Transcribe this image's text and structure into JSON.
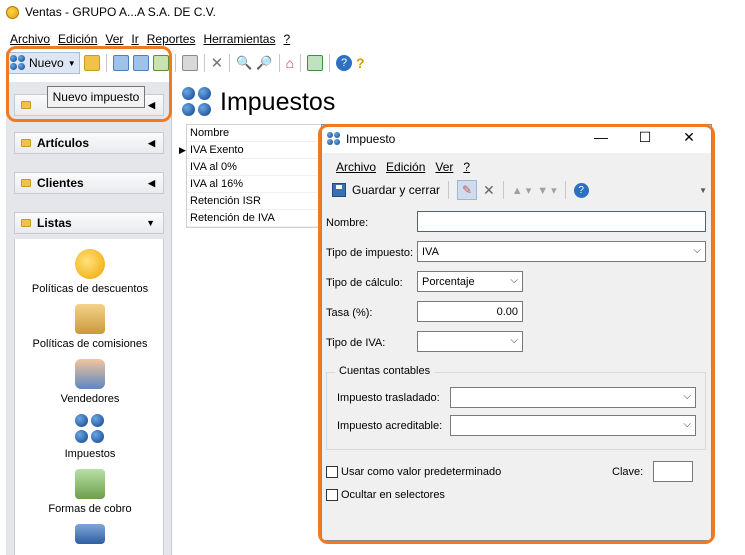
{
  "window": {
    "title": "Ventas - GRUPO A...A S.A. DE C.V."
  },
  "menu": [
    "Archivo",
    "Edición",
    "Ver",
    "Ir",
    "Reportes",
    "Herramientas",
    "?"
  ],
  "toolbar": {
    "nuevo_label": "Nuevo"
  },
  "tooltip": "Nuevo impuesto",
  "sidebar": {
    "groups": [
      "Artículos",
      "Clientes",
      "Listas"
    ],
    "items": [
      {
        "label": "Políticas de descuentos",
        "icon": "discount-icon"
      },
      {
        "label": "Políticas de comisiones",
        "icon": "commission-icon"
      },
      {
        "label": "Vendedores",
        "icon": "salesperson-icon"
      },
      {
        "label": "Impuestos",
        "icon": "taxes-icon"
      },
      {
        "label": "Formas de cobro",
        "icon": "payment-icon"
      }
    ]
  },
  "main": {
    "title": "Impuestos",
    "grid": {
      "header": "Nombre",
      "rows": [
        "IVA Exento",
        "IVA al 0%",
        "IVA al 16%",
        "Retención ISR",
        "Retención de IVA"
      ]
    }
  },
  "dialog": {
    "title": "Impuesto",
    "menu": [
      "Archivo",
      "Edición",
      "Ver",
      "?"
    ],
    "save_label": "Guardar y cerrar",
    "fields": {
      "nombre_label": "Nombre:",
      "nombre_value": "",
      "tipo_impuesto_label": "Tipo de impuesto:",
      "tipo_impuesto_value": "IVA",
      "tipo_calculo_label": "Tipo de cálculo:",
      "tipo_calculo_value": "Porcentaje",
      "tasa_label": "Tasa (%):",
      "tasa_value": "0.00",
      "tipo_iva_label": "Tipo de IVA:",
      "tipo_iva_value": ""
    },
    "cuentas": {
      "legend": "Cuentas contables",
      "trasladado_label": "Impuesto trasladado:",
      "acreditable_label": "Impuesto acreditable:"
    },
    "checkboxes": {
      "predeterminado": "Usar como valor predeterminado",
      "ocultar": "Ocultar en selectores"
    },
    "clave_label": "Clave:",
    "clave_value": ""
  },
  "colors": {
    "highlight": "#f07a22",
    "accent": "#0e3f86"
  }
}
